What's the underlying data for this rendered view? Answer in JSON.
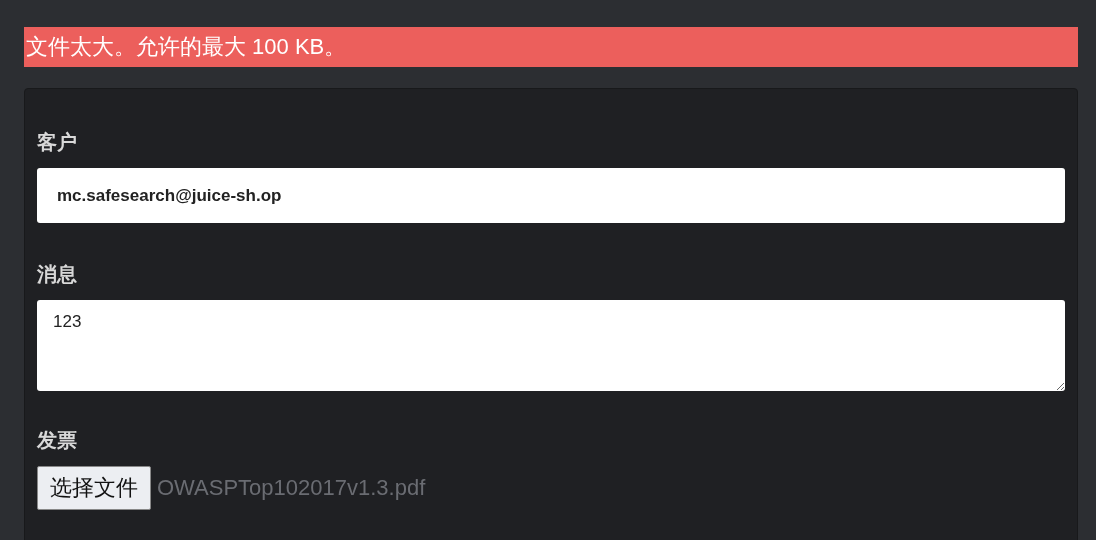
{
  "error_banner": "文件太大。允许的最大 100 KB。",
  "form": {
    "fields": [
      {
        "kind": "input",
        "label": "客户",
        "value": "mc.safesearch@juice-sh.op"
      },
      {
        "kind": "textarea",
        "label": "消息",
        "value": "123"
      },
      {
        "kind": "file",
        "label": "发票",
        "button": "选择文件",
        "file_name": "OWASPTop102017v1.3.pdf"
      }
    ]
  }
}
